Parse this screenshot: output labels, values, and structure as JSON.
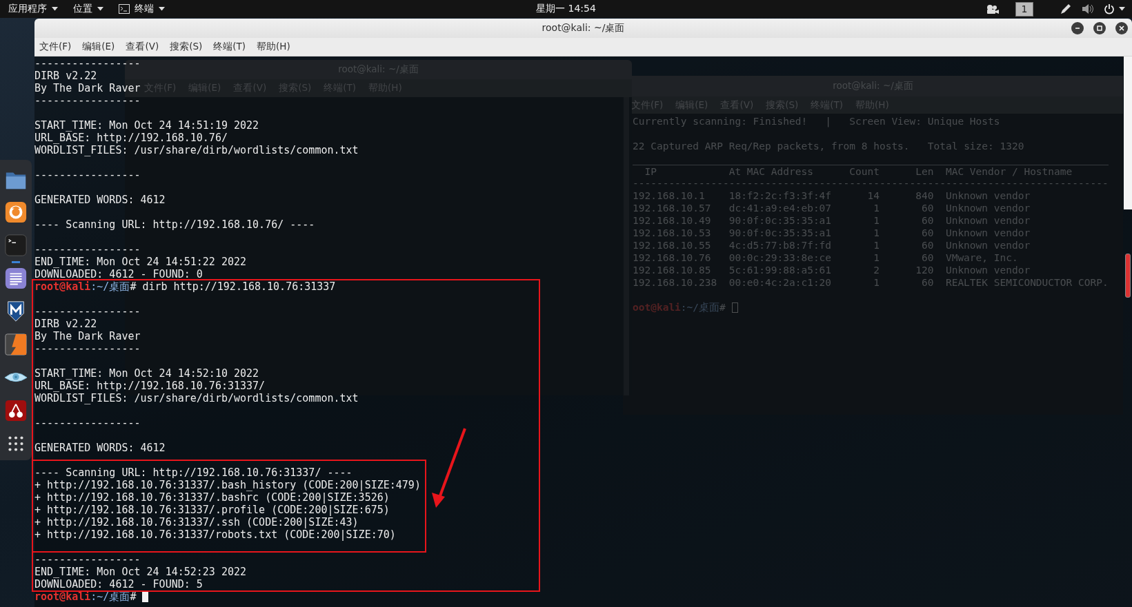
{
  "top_bar": {
    "menus": [
      {
        "kind": "menu",
        "label": "应用程序"
      },
      {
        "kind": "menu",
        "label": "位置"
      },
      {
        "kind": "app",
        "label": "终端"
      }
    ],
    "clock": "星期一 14:54",
    "workspace": "1"
  },
  "dock": {
    "items": [
      {
        "kind": "folder",
        "running": false
      },
      {
        "kind": "browser",
        "running": false
      },
      {
        "kind": "terminal",
        "running": true
      },
      {
        "kind": "notes",
        "running": false
      },
      {
        "kind": "shield",
        "running": false
      },
      {
        "kind": "bolt",
        "running": false
      },
      {
        "kind": "eye",
        "running": false
      },
      {
        "kind": "cherry",
        "running": false
      },
      {
        "kind": "grid",
        "running": false
      }
    ]
  },
  "background_windows": {
    "ifconfig_window": {
      "title": "root@kali: ~/桌面",
      "menu": [
        "文件(F)",
        "编辑(E)",
        "查看(V)",
        "搜索(S)",
        "终端(T)",
        "帮助(H)"
      ]
    },
    "netdiscover_window": {
      "title": "root@kali: ~/桌面",
      "menu": [
        "文件(F)",
        "编辑(E)",
        "查看(V)",
        "搜索(S)",
        "终端(T)",
        "帮助(H)"
      ],
      "status": "Currently scanning: Finished!   |   Screen View: Unique Hosts",
      "summary": "22 Captured ARP Req/Rep packets, from 8 hosts.   Total size: 1320",
      "columns": [
        "IP",
        "At MAC Address",
        "Count",
        "Len",
        "MAC Vendor / Hostname"
      ],
      "separator": "-------------------------------------------------------------------------------",
      "hosts": [
        {
          "ip": "192.168.10.1",
          "mac": "18:f2:2c:f3:3f:4f",
          "count": "14",
          "len": "840",
          "vendor": "Unknown vendor"
        },
        {
          "ip": "192.168.10.57",
          "mac": "dc:41:a9:e4:eb:07",
          "count": "1",
          "len": "60",
          "vendor": "Unknown vendor"
        },
        {
          "ip": "192.168.10.49",
          "mac": "90:0f:0c:35:35:a1",
          "count": "1",
          "len": "60",
          "vendor": "Unknown vendor"
        },
        {
          "ip": "192.168.10.53",
          "mac": "90:0f:0c:35:35:a1",
          "count": "1",
          "len": "60",
          "vendor": "Unknown vendor"
        },
        {
          "ip": "192.168.10.55",
          "mac": "4c:d5:77:b8:7f:fd",
          "count": "1",
          "len": "60",
          "vendor": "Unknown vendor"
        },
        {
          "ip": "192.168.10.76",
          "mac": "00:0c:29:33:8e:ce",
          "count": "1",
          "len": "60",
          "vendor": "VMware, Inc."
        },
        {
          "ip": "192.168.10.85",
          "mac": "5c:61:99:88:a5:61",
          "count": "2",
          "len": "120",
          "vendor": "Unknown vendor"
        },
        {
          "ip": "192.168.10.238",
          "mac": "00:e0:4c:2a:c1:20",
          "count": "1",
          "len": "60",
          "vendor": "REALTEK SEMICONDUCTOR CORP."
        }
      ],
      "prompt": {
        "user": "oot@kali",
        "path": ":~/桌面",
        "symbol": "#",
        "cursor": true,
        "focused": false
      }
    }
  },
  "terminal": {
    "title": "root@kali: ~/桌面",
    "menu": [
      "文件(F)",
      "编辑(E)",
      "查看(V)",
      "搜索(S)",
      "终端(T)",
      "帮助(H)"
    ],
    "lines": [
      {
        "kind": "text",
        "text": "-----------------"
      },
      {
        "kind": "text",
        "text": "DIRB v2.22"
      },
      {
        "kind": "text",
        "text": "By The Dark Raver"
      },
      {
        "kind": "text",
        "text": "-----------------"
      },
      {
        "kind": "blank"
      },
      {
        "kind": "text",
        "text": "START_TIME: Mon Oct 24 14:51:19 2022"
      },
      {
        "kind": "text",
        "text": "URL_BASE: http://192.168.10.76/"
      },
      {
        "kind": "text",
        "text": "WORDLIST_FILES: /usr/share/dirb/wordlists/common.txt"
      },
      {
        "kind": "blank"
      },
      {
        "kind": "text",
        "text": "-----------------"
      },
      {
        "kind": "blank"
      },
      {
        "kind": "text",
        "text": "GENERATED WORDS: 4612"
      },
      {
        "kind": "blank"
      },
      {
        "kind": "text",
        "text": "---- Scanning URL: http://192.168.10.76/ ----"
      },
      {
        "kind": "blank"
      },
      {
        "kind": "text",
        "text": "-----------------"
      },
      {
        "kind": "text",
        "text": "END_TIME: Mon Oct 24 14:51:22 2022"
      },
      {
        "kind": "text",
        "text": "DOWNLOADED: 4612 - FOUND: 0"
      },
      {
        "kind": "prompt",
        "user": "root@kali",
        "path": ":~/桌面",
        "symbol": "#",
        "command": " dirb http://192.168.10.76:31337"
      },
      {
        "kind": "blank"
      },
      {
        "kind": "text",
        "text": "-----------------"
      },
      {
        "kind": "text",
        "text": "DIRB v2.22"
      },
      {
        "kind": "text",
        "text": "By The Dark Raver"
      },
      {
        "kind": "text",
        "text": "-----------------"
      },
      {
        "kind": "blank"
      },
      {
        "kind": "text",
        "text": "START_TIME: Mon Oct 24 14:52:10 2022"
      },
      {
        "kind": "text",
        "text": "URL_BASE: http://192.168.10.76:31337/"
      },
      {
        "kind": "text",
        "text": "WORDLIST_FILES: /usr/share/dirb/wordlists/common.txt"
      },
      {
        "kind": "blank"
      },
      {
        "kind": "text",
        "text": "-----------------"
      },
      {
        "kind": "blank"
      },
      {
        "kind": "text",
        "text": "GENERATED WORDS: 4612"
      },
      {
        "kind": "blank"
      },
      {
        "kind": "text",
        "text": "---- Scanning URL: http://192.168.10.76:31337/ ----"
      },
      {
        "kind": "text",
        "text": "+ http://192.168.10.76:31337/.bash_history (CODE:200|SIZE:479)"
      },
      {
        "kind": "text",
        "text": "+ http://192.168.10.76:31337/.bashrc (CODE:200|SIZE:3526)"
      },
      {
        "kind": "text",
        "text": "+ http://192.168.10.76:31337/.profile (CODE:200|SIZE:675)"
      },
      {
        "kind": "text",
        "text": "+ http://192.168.10.76:31337/.ssh (CODE:200|SIZE:43)"
      },
      {
        "kind": "text",
        "text": "+ http://192.168.10.76:31337/robots.txt (CODE:200|SIZE:70)"
      },
      {
        "kind": "blank"
      },
      {
        "kind": "text",
        "text": "-----------------"
      },
      {
        "kind": "text",
        "text": "END_TIME: Mon Oct 24 14:52:23 2022"
      },
      {
        "kind": "text",
        "text": "DOWNLOADED: 4612 - FOUND: 5"
      },
      {
        "kind": "prompt",
        "user": "root@kali",
        "path": ":~/桌面",
        "symbol": "#",
        "cursor": true,
        "focused": true
      }
    ]
  },
  "annotations": [
    {
      "kind": "box"
    },
    {
      "kind": "box"
    },
    {
      "kind": "arrow"
    }
  ]
}
